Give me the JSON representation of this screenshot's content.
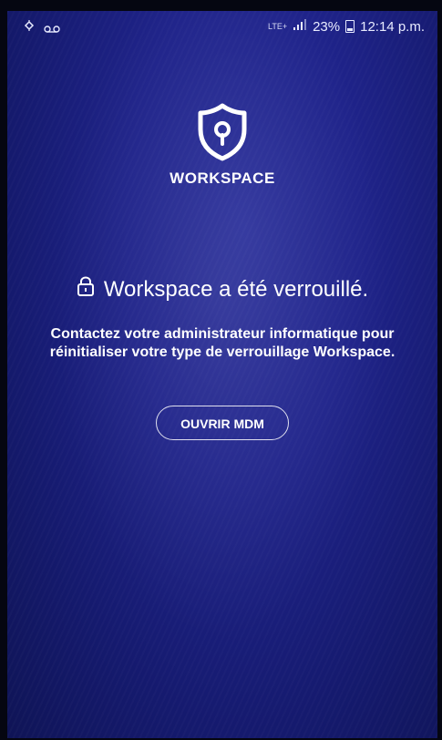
{
  "status_bar": {
    "left_icons": [
      "location-sync-icon",
      "voicemail-icon"
    ],
    "network_label": "LTE+",
    "battery": "23%",
    "time": "12:14 p.m."
  },
  "workspace": {
    "brand": "WORKSPACE",
    "heading": "Workspace a été verrouillé.",
    "description": "Contactez votre administrateur informatique pour réinitialiser votre type de verrouillage Workspace.",
    "open_mdm_label": "OUVRIR MDM"
  },
  "colors": {
    "background": "#1f238a",
    "accent": "#ffffff"
  }
}
